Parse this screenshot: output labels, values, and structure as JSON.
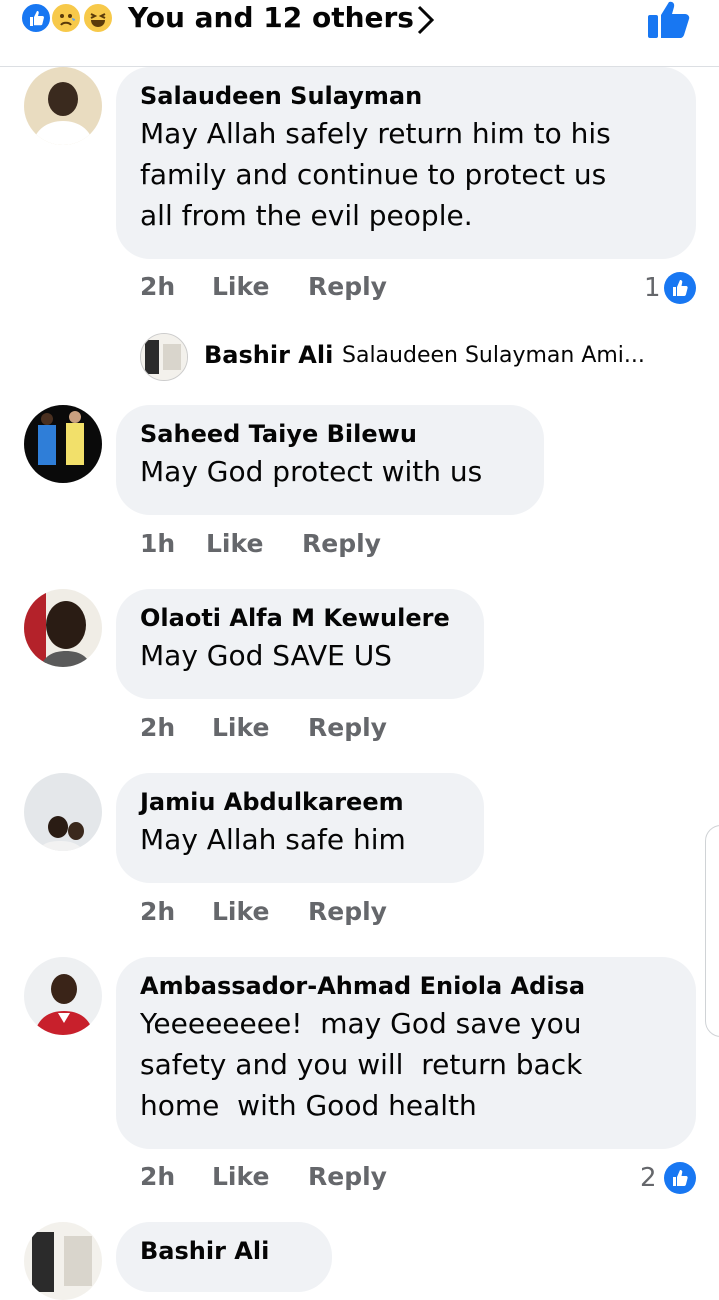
{
  "header": {
    "reactions_text": "You and 12 others",
    "reaction_icons": [
      "like-icon",
      "sad-icon",
      "haha-icon"
    ]
  },
  "comments": [
    {
      "name": "Salaudeen Sulayman",
      "text": "May Allah safely return him to his\nfamily and continue to protect us\nall from the evil people.",
      "time": "2h",
      "like": "Like",
      "reply": "Reply",
      "like_count": "1"
    },
    {
      "name": "Saheed Taiye Bilewu",
      "text": "May God protect with us",
      "time": "1h",
      "like": "Like",
      "reply": "Reply"
    },
    {
      "name": "Olaoti Alfa M Kewulere",
      "text": "May God SAVE US",
      "time": "2h",
      "like": "Like",
      "reply": "Reply"
    },
    {
      "name": "Jamiu Abdulkareem",
      "text": "May Allah safe him",
      "time": "2h",
      "like": "Like",
      "reply": "Reply"
    },
    {
      "name": "Ambassador-Ahmad Eniola Adisa",
      "text": "Yeeeeeeee!  may God save you\nsafety and you will  return back\nhome  with Good health",
      "time": "2h",
      "like": "Like",
      "reply": "Reply",
      "like_count": "2"
    },
    {
      "name": "Bashir Ali"
    }
  ],
  "reply_preview": {
    "name": "Bashir Ali",
    "snippet": "Salaudeen Sulayman Ami..."
  },
  "colors": {
    "accent": "#1877f2",
    "bubble": "#f0f2f5",
    "meta": "#65676b"
  }
}
